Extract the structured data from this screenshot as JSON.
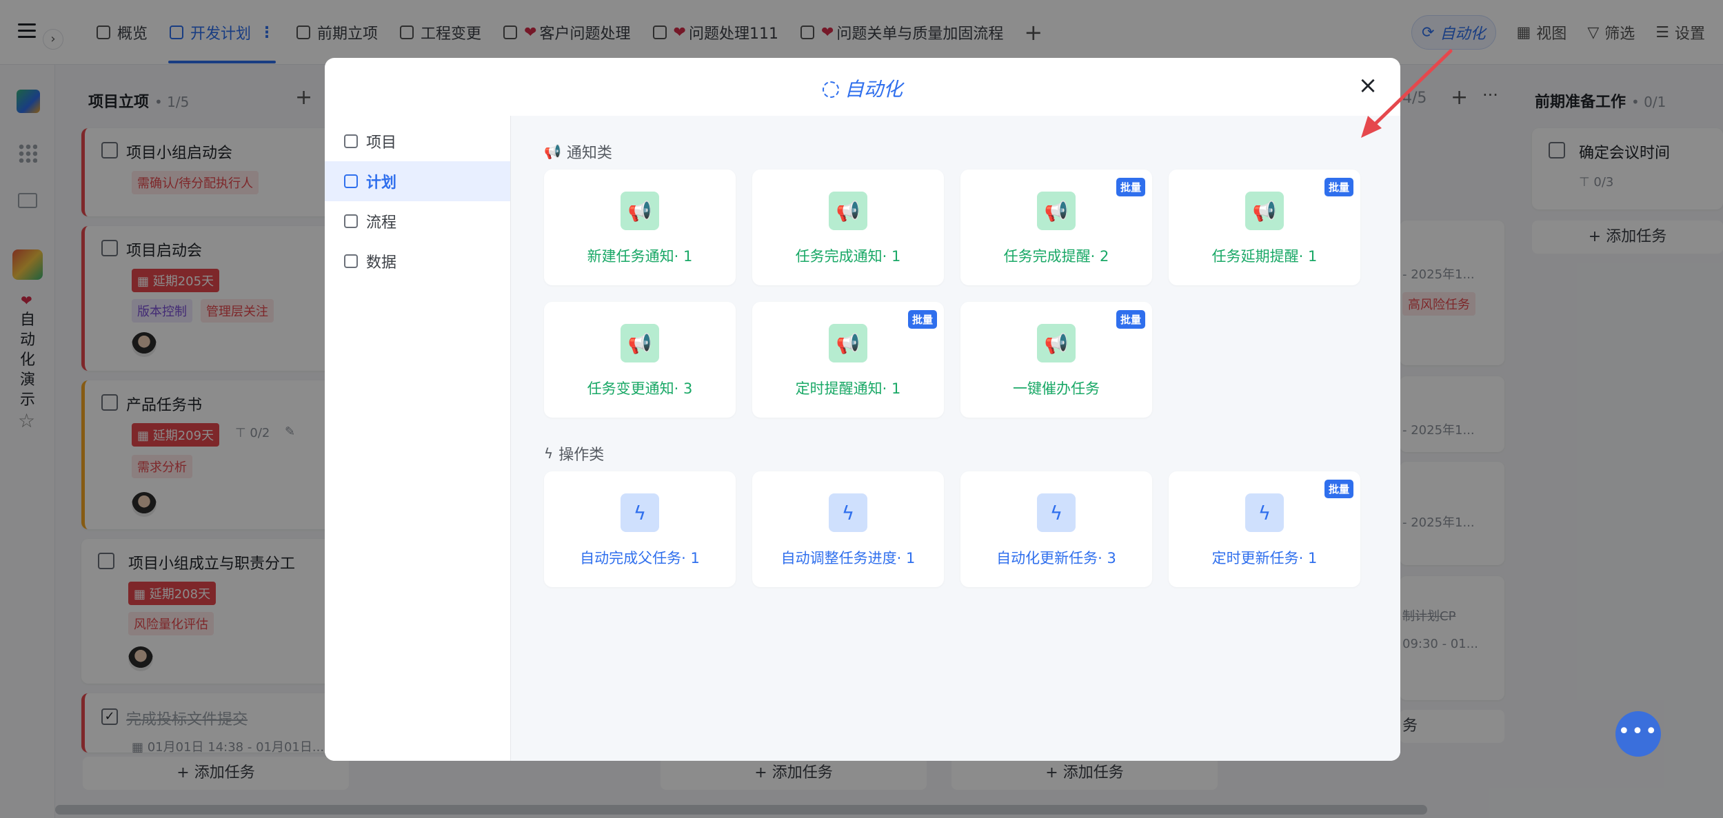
{
  "topbar": {
    "tabs": [
      {
        "label": "概览",
        "active": false
      },
      {
        "label": "开发计划",
        "active": true,
        "more": "⋮"
      },
      {
        "label": "前期立项",
        "active": false
      },
      {
        "label": "工程变更",
        "active": false
      },
      {
        "label": "客户问题处理",
        "active": false,
        "heart": "❤"
      },
      {
        "label": "问题处理111",
        "active": false,
        "heart": "❤"
      },
      {
        "label": "问题关单与质量加固流程",
        "active": false,
        "heart": "❤"
      }
    ],
    "add_tab": "+",
    "tools": {
      "automation": "自动化",
      "view": "视图",
      "filter": "筛选",
      "settings": "设置"
    }
  },
  "leftbar": {
    "app_name_vertical": "自动化演示"
  },
  "board": {
    "col1": {
      "title": "项目立项",
      "count": "• 1/5",
      "cards": [
        {
          "title": "项目小组启动会",
          "tags": [
            "需确认/待分配执行人"
          ]
        },
        {
          "title": "项目启动会",
          "delay": "延期205天",
          "tags": [
            "版本控制",
            "管理层关注"
          ]
        },
        {
          "title": "产品任务书",
          "delay": "延期209天",
          "sub": "0/2",
          "tags": [
            "需求分析"
          ]
        },
        {
          "title": "项目小组成立与职责分工",
          "delay": "延期208天",
          "tags": [
            "风险量化评估"
          ]
        },
        {
          "title": "完成投标文件提交",
          "sub": "01月01日 14:38 - 01月01日..."
        }
      ]
    },
    "col_right_count": "4/5",
    "col_right_more": "···",
    "peek_texts": [
      "- 2025年1...",
      "高风险任务",
      "- 2025年1...",
      "- 2025年1...",
      "制计划CP",
      "09:30 - 01...",
      "务"
    ],
    "col_last": {
      "title": "前期准备工作",
      "count": "• 0/1",
      "card_title": "确定会议时间",
      "card_sub": "0/3",
      "add_task": "添加任务"
    },
    "add_task_label": "添加任务"
  },
  "modal": {
    "title": "自动化",
    "close": "×",
    "nav": [
      {
        "label": "项目",
        "active": false
      },
      {
        "label": "计划",
        "active": true
      },
      {
        "label": "流程",
        "active": false
      },
      {
        "label": "数据",
        "active": false
      }
    ],
    "sections": [
      {
        "title": "通知类",
        "icon": "megaphone-icon",
        "items": [
          {
            "label": "新建任务通知· 1",
            "batch": false
          },
          {
            "label": "任务完成通知· 1",
            "batch": false
          },
          {
            "label": "任务完成提醒· 2",
            "batch": true
          },
          {
            "label": "任务延期提醒· 1",
            "batch": true
          },
          {
            "label": "任务变更通知· 3",
            "batch": false
          },
          {
            "label": "定时提醒通知· 1",
            "batch": true
          },
          {
            "label": "一键催办任务",
            "batch": true
          }
        ]
      },
      {
        "title": "操作类",
        "icon": "lightning-icon",
        "items": [
          {
            "label": "自动完成父任务· 1",
            "batch": false
          },
          {
            "label": "自动调整任务进度· 1",
            "batch": false
          },
          {
            "label": "自动化更新任务· 3",
            "batch": false
          },
          {
            "label": "定时更新任务· 1",
            "batch": true
          }
        ]
      }
    ],
    "batch_label": "批量"
  },
  "fab": "•••",
  "colors": {
    "accent": "#2f6fed",
    "notify_green": "#19a866",
    "danger": "#e5484d",
    "arrow": "#e5484d"
  }
}
